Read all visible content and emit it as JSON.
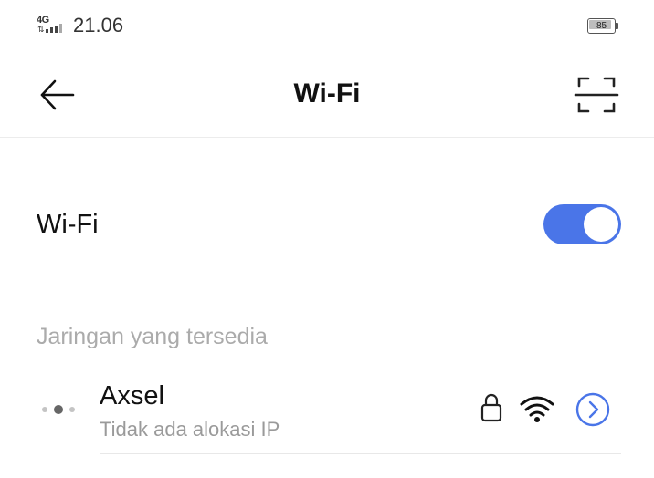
{
  "status_bar": {
    "network_type": "4G",
    "time": "21.06",
    "battery_level": "85",
    "icons": [
      "signal-icon",
      "battery-icon"
    ]
  },
  "header": {
    "title": "Wi-Fi",
    "back_icon": "arrow-left-icon",
    "scan_icon": "qr-scan-icon"
  },
  "wifi_toggle": {
    "label": "Wi-Fi",
    "enabled": true,
    "accent_color": "#4a75e8"
  },
  "available_networks": {
    "header": "Jaringan yang tersedia",
    "networks": [
      {
        "name": "Axsel",
        "status": "Tidak ada alokasi IP",
        "secured": true,
        "icons": [
          "connecting-dots-icon",
          "lock-icon",
          "wifi-signal-icon",
          "chevron-right-circle-icon"
        ]
      }
    ]
  }
}
